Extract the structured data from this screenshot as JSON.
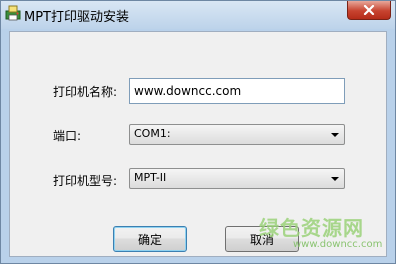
{
  "window": {
    "title": "MPT打印驱动安装",
    "close_label": "✕",
    "icons": {
      "app": "printer-installer-icon",
      "close": "close-icon"
    }
  },
  "form": {
    "printer_name": {
      "label": "打印机名称:",
      "value": "www.downcc.com"
    },
    "port": {
      "label": "端口:",
      "selected": "COM1:",
      "icon": "chevron-down-icon"
    },
    "printer_model": {
      "label": "打印机型号:",
      "selected": "MPT-II",
      "icon": "chevron-down-icon"
    }
  },
  "buttons": {
    "ok": "确定",
    "cancel": "取消"
  },
  "watermark": {
    "brand": "绿色资源网",
    "url": "www.downcc.com"
  },
  "colors": {
    "titlebar": "#bdd3ea",
    "client_bg": "#f0f0f0",
    "close_red": "#c7432f",
    "watermark_green": "#9bd27a"
  }
}
